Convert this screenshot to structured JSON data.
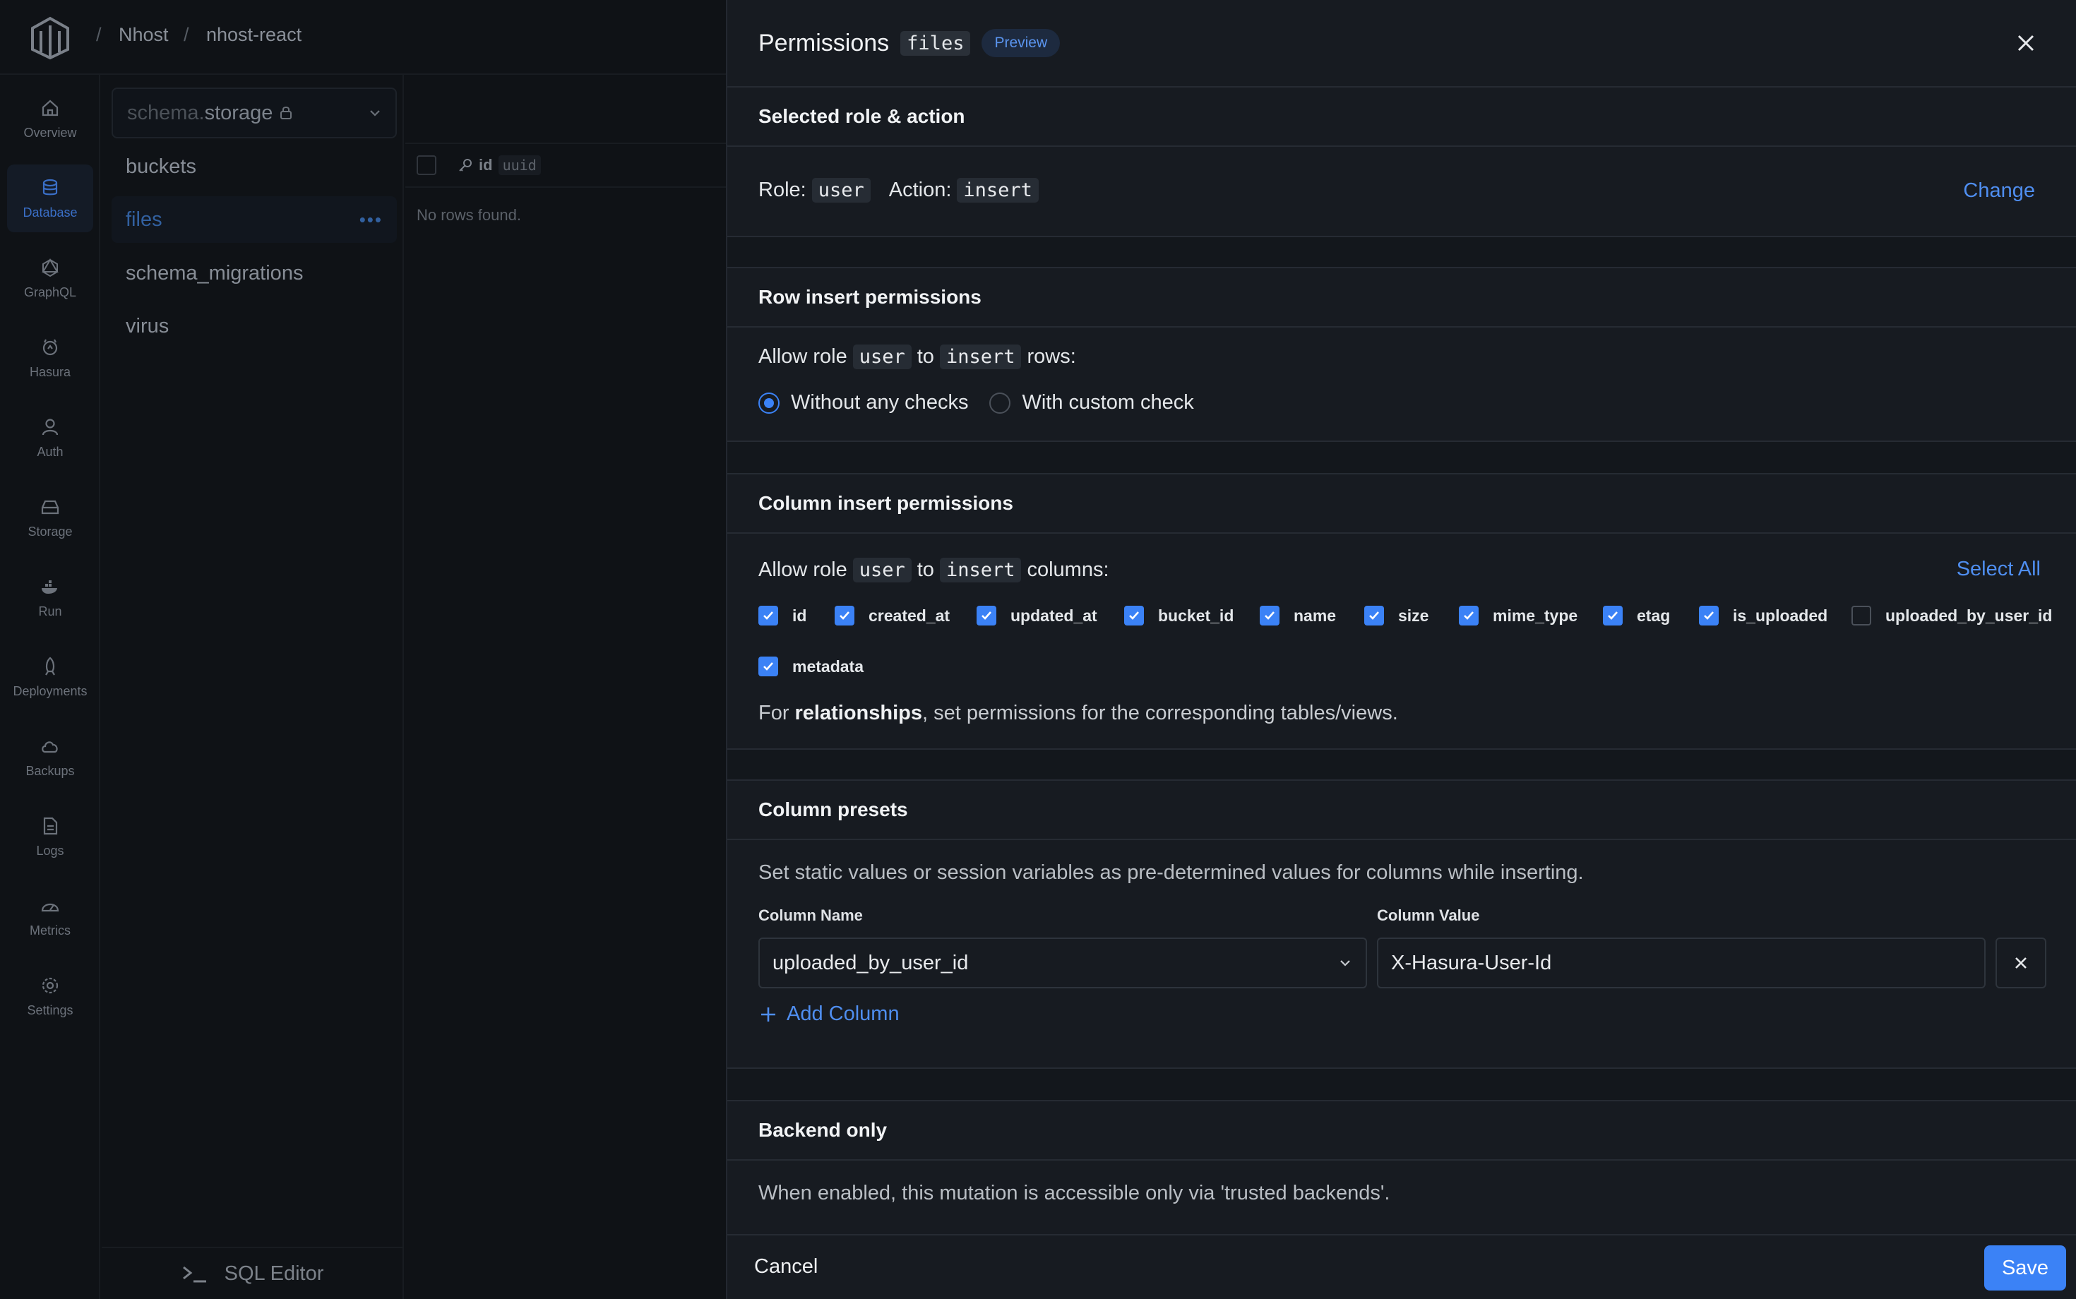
{
  "breadcrumb": {
    "org": "Nhost",
    "project": "nhost-react",
    "separator": "/"
  },
  "sidenav": {
    "items": [
      {
        "label": "Overview",
        "icon": "home-icon"
      },
      {
        "label": "Database",
        "icon": "database-icon"
      },
      {
        "label": "GraphQL",
        "icon": "graphql-icon"
      },
      {
        "label": "Hasura",
        "icon": "hasura-icon"
      },
      {
        "label": "Auth",
        "icon": "user-icon"
      },
      {
        "label": "Storage",
        "icon": "storage-icon"
      },
      {
        "label": "Run",
        "icon": "run-icon"
      },
      {
        "label": "Deployments",
        "icon": "rocket-icon"
      },
      {
        "label": "Backups",
        "icon": "cloud-icon"
      },
      {
        "label": "Logs",
        "icon": "file-icon"
      },
      {
        "label": "Metrics",
        "icon": "gauge-icon"
      },
      {
        "label": "Settings",
        "icon": "gear-icon"
      }
    ],
    "active": "Database"
  },
  "tables": {
    "schema_prefix": "schema.",
    "schema_name": "storage",
    "items": [
      "buckets",
      "files",
      "schema_migrations",
      "virus"
    ],
    "active": "files",
    "sql_editor_label": "SQL Editor"
  },
  "grid": {
    "column_name": "id",
    "column_type": "uuid",
    "empty_text": "No rows found."
  },
  "drawer": {
    "title": "Permissions",
    "table_tag": "files",
    "badge": "Preview",
    "selected": {
      "heading": "Selected role & action",
      "role_label": "Role:",
      "role": "user",
      "action_label": "Action:",
      "action": "insert",
      "change_label": "Change"
    },
    "row_perms": {
      "heading": "Row insert permissions",
      "allow_prefix": "Allow role",
      "role": "user",
      "to": "to",
      "action": "insert",
      "suffix": "rows:",
      "options": [
        "Without any checks",
        "With custom check"
      ],
      "selected_option": "Without any checks"
    },
    "column_perms": {
      "heading": "Column insert permissions",
      "allow_prefix": "Allow role",
      "role": "user",
      "to": "to",
      "action": "insert",
      "suffix": "columns:",
      "select_all_label": "Select All",
      "columns": [
        {
          "name": "id",
          "checked": true
        },
        {
          "name": "created_at",
          "checked": true
        },
        {
          "name": "updated_at",
          "checked": true
        },
        {
          "name": "bucket_id",
          "checked": true
        },
        {
          "name": "name",
          "checked": true
        },
        {
          "name": "size",
          "checked": true
        },
        {
          "name": "mime_type",
          "checked": true
        },
        {
          "name": "etag",
          "checked": true
        },
        {
          "name": "is_uploaded",
          "checked": true
        },
        {
          "name": "uploaded_by_user_id",
          "checked": false
        },
        {
          "name": "metadata",
          "checked": true
        }
      ],
      "note_prefix": "For",
      "note_bold": "relationships",
      "note_suffix": ", set permissions for the corresponding tables/views."
    },
    "presets": {
      "heading": "Column presets",
      "description": "Set static values or session variables as pre-determined values for columns while inserting.",
      "name_label": "Column Name",
      "value_label": "Column Value",
      "column_name": "uploaded_by_user_id",
      "column_value": "X-Hasura-User-Id",
      "add_label": "Add Column"
    },
    "backend": {
      "heading": "Backend only",
      "description": "When enabled, this mutation is accessible only via 'trusted backends'."
    },
    "footer": {
      "cancel_label": "Cancel",
      "save_label": "Save"
    }
  }
}
